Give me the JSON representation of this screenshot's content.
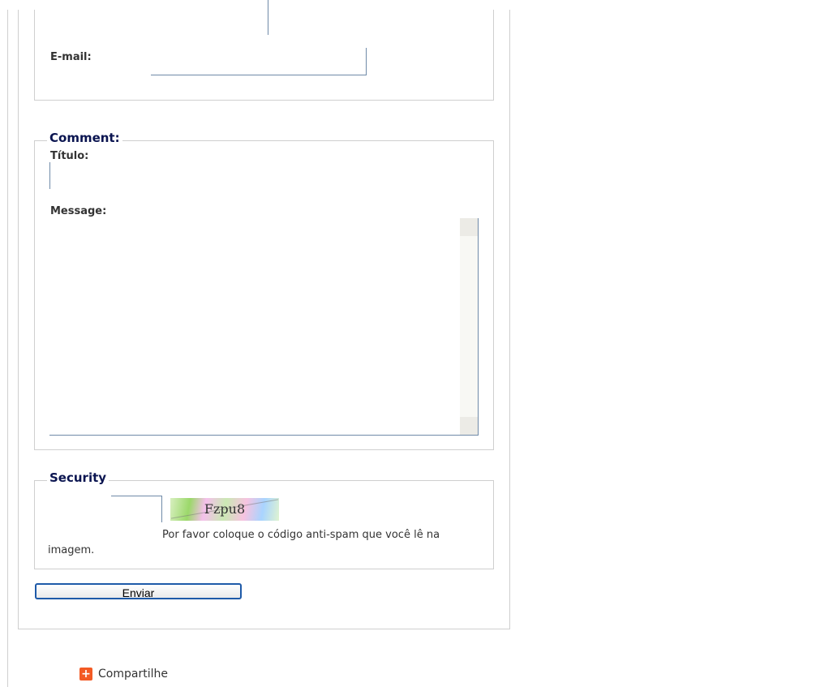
{
  "contact": {
    "email_label": "E-mail:"
  },
  "comment": {
    "legend": "Comment:",
    "title_label": "Título:",
    "message_label": "Message:"
  },
  "security": {
    "legend": "Security",
    "captcha_text": "Fzpu8",
    "help_text_line1": "Por favor coloque o código anti-spam que você lê na",
    "help_text_line2": "imagem."
  },
  "submit": {
    "label": "Enviar"
  },
  "share": {
    "label": "Compartilhe",
    "icon_glyph": "+"
  },
  "colors": {
    "legend": "#0a1450",
    "border": "#cfcfcf",
    "input_border": "#6f8aa8",
    "button_border": "#1e5aa8",
    "share_icon": "#f35a24"
  }
}
